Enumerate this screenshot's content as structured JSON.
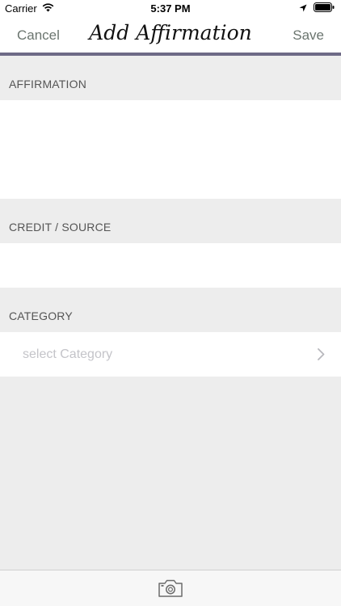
{
  "status_bar": {
    "carrier": "Carrier",
    "time": "5:37 PM"
  },
  "nav": {
    "cancel_label": "Cancel",
    "title": "Add Affirmation",
    "save_label": "Save"
  },
  "sections": {
    "affirmation": {
      "header": "AFFIRMATION",
      "value": ""
    },
    "credit": {
      "header": "CREDIT / SOURCE",
      "value": ""
    },
    "category": {
      "header": "CATEGORY",
      "placeholder": "select Category"
    }
  },
  "icons": {
    "wifi": "wifi-icon",
    "location": "location-arrow-icon",
    "battery": "battery-icon",
    "chevron": "chevron-right-icon",
    "camera": "camera-icon"
  },
  "colors": {
    "nav_button": "#6b756f",
    "nav_underline": "#6e6a86",
    "background": "#ededed",
    "placeholder": "#c4c4c9"
  }
}
